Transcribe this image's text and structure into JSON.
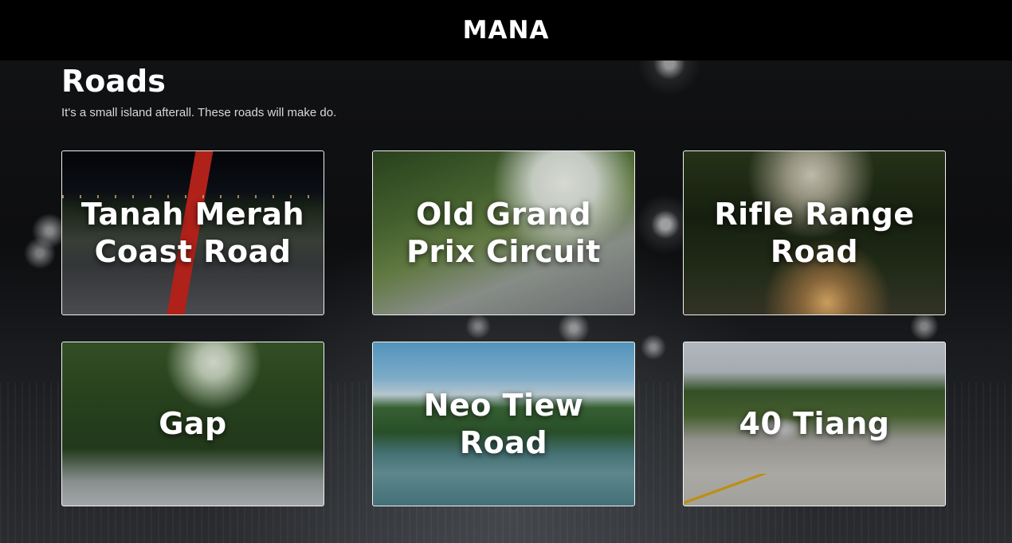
{
  "header": {
    "brand": "MANA"
  },
  "main": {
    "title": "Roads",
    "subtitle": "It's a small island afterall. These roads will make do.",
    "cards": [
      {
        "label": "Tanah Merah Coast Road"
      },
      {
        "label": "Old Grand Prix Circuit"
      },
      {
        "label": "Rifle Range Road"
      },
      {
        "label": "Gap"
      },
      {
        "label": "Neo Tiew Road"
      },
      {
        "label": "40 Tiang"
      }
    ]
  },
  "colors": {
    "header_bg": "#000000",
    "card_border": "#f2f2f2",
    "text": "#ffffff"
  }
}
